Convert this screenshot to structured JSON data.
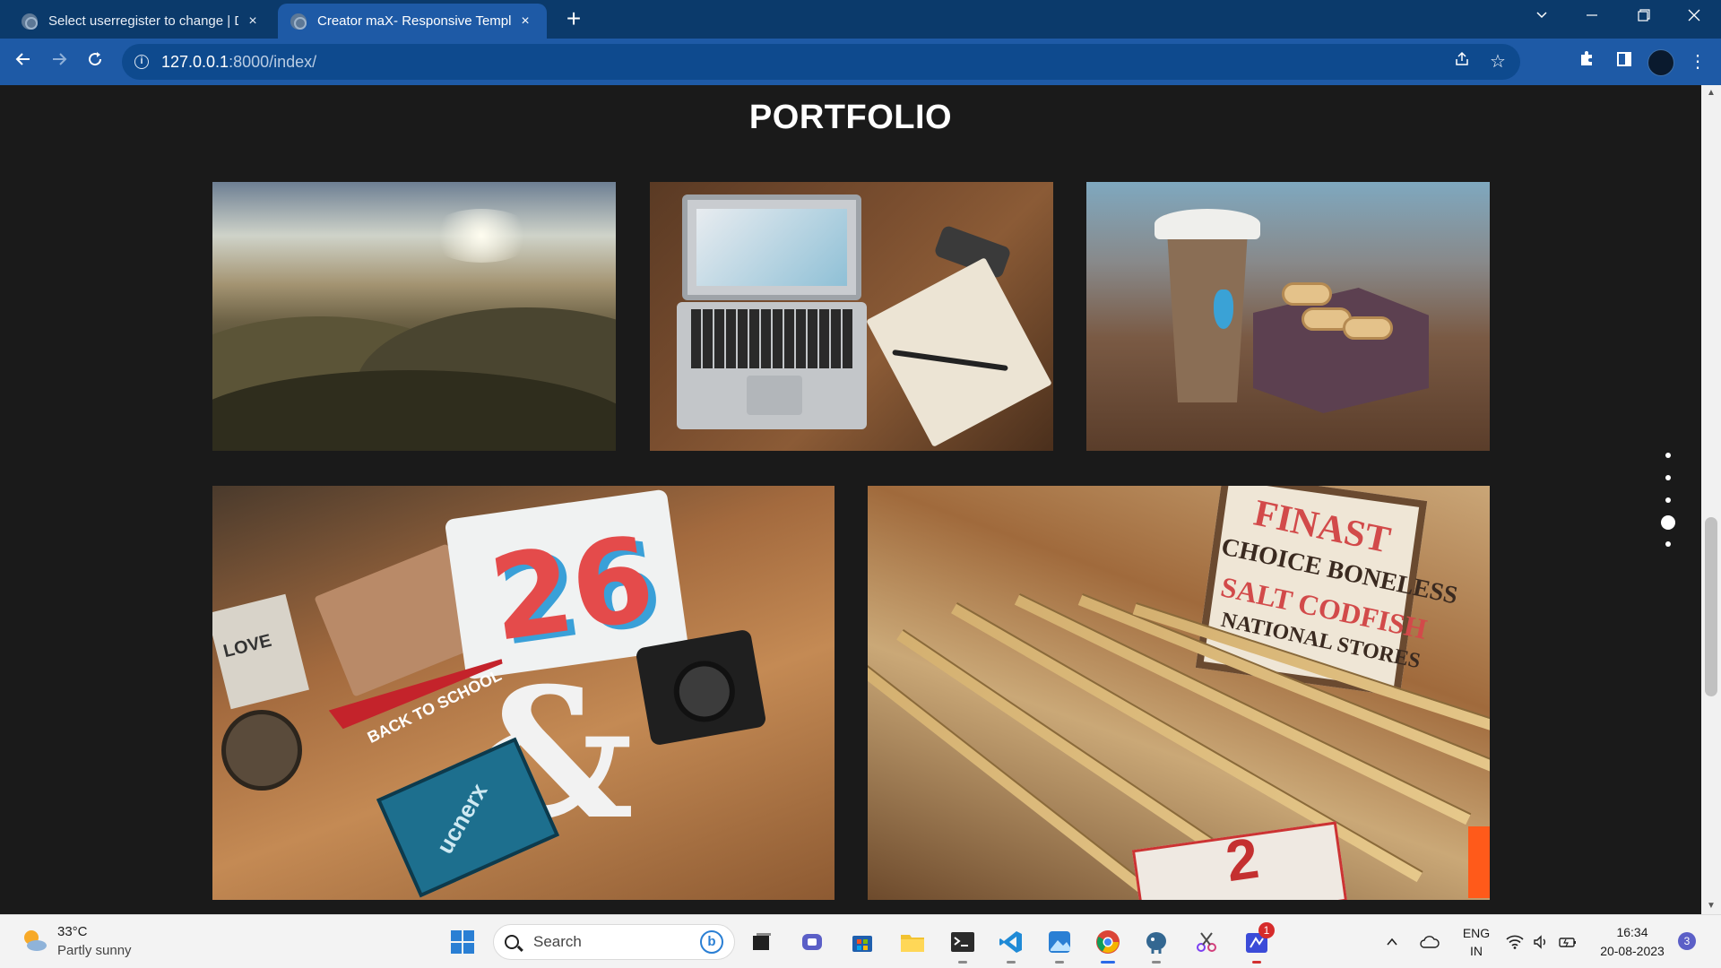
{
  "browser": {
    "tabs": [
      {
        "title": "Select userregister to change | Dj",
        "active": false
      },
      {
        "title": "Creator maX- Responsive Templa",
        "active": true
      }
    ],
    "url_host": "127.0.0.1",
    "url_path": ":8000/index/",
    "close_glyph": "×",
    "new_tab_glyph": "+"
  },
  "page": {
    "heading": "PORTFOLIO",
    "photos": [
      {
        "name": "portfolio-photo-landscape"
      },
      {
        "name": "portfolio-photo-laptop-desk"
      },
      {
        "name": "portfolio-photo-coffee-macarons"
      },
      {
        "name": "portfolio-photo-flatlay-tshirt"
      },
      {
        "name": "portfolio-photo-rulers-sign"
      }
    ],
    "flatlay_text": {
      "love": "LOVE",
      "pennant": "BACK TO SCHOOL",
      "book": "ucnerx",
      "ampersand": "&"
    },
    "sign_text": {
      "line1": "FINAST",
      "line2": "CHOICE BONELESS",
      "line3": "SALT CODFISH",
      "line4": "NATIONAL STORES",
      "card_number": "2"
    },
    "nav_dots": {
      "count": 5,
      "active_index": 3
    }
  },
  "taskbar": {
    "weather_temp": "33°C",
    "weather_desc": "Partly sunny",
    "search_label": "Search",
    "bing_label": "b",
    "lang_top": "ENG",
    "lang_bottom": "IN",
    "time": "16:34",
    "date": "20-08-2023",
    "notification_count": "3",
    "app_badge": "1"
  },
  "colors": {
    "tabbar": "#0b3a6b",
    "toolbar": "#1e5aa6",
    "page_bg": "#1a1a1a",
    "taskbar_bg": "#f3f3f3"
  }
}
